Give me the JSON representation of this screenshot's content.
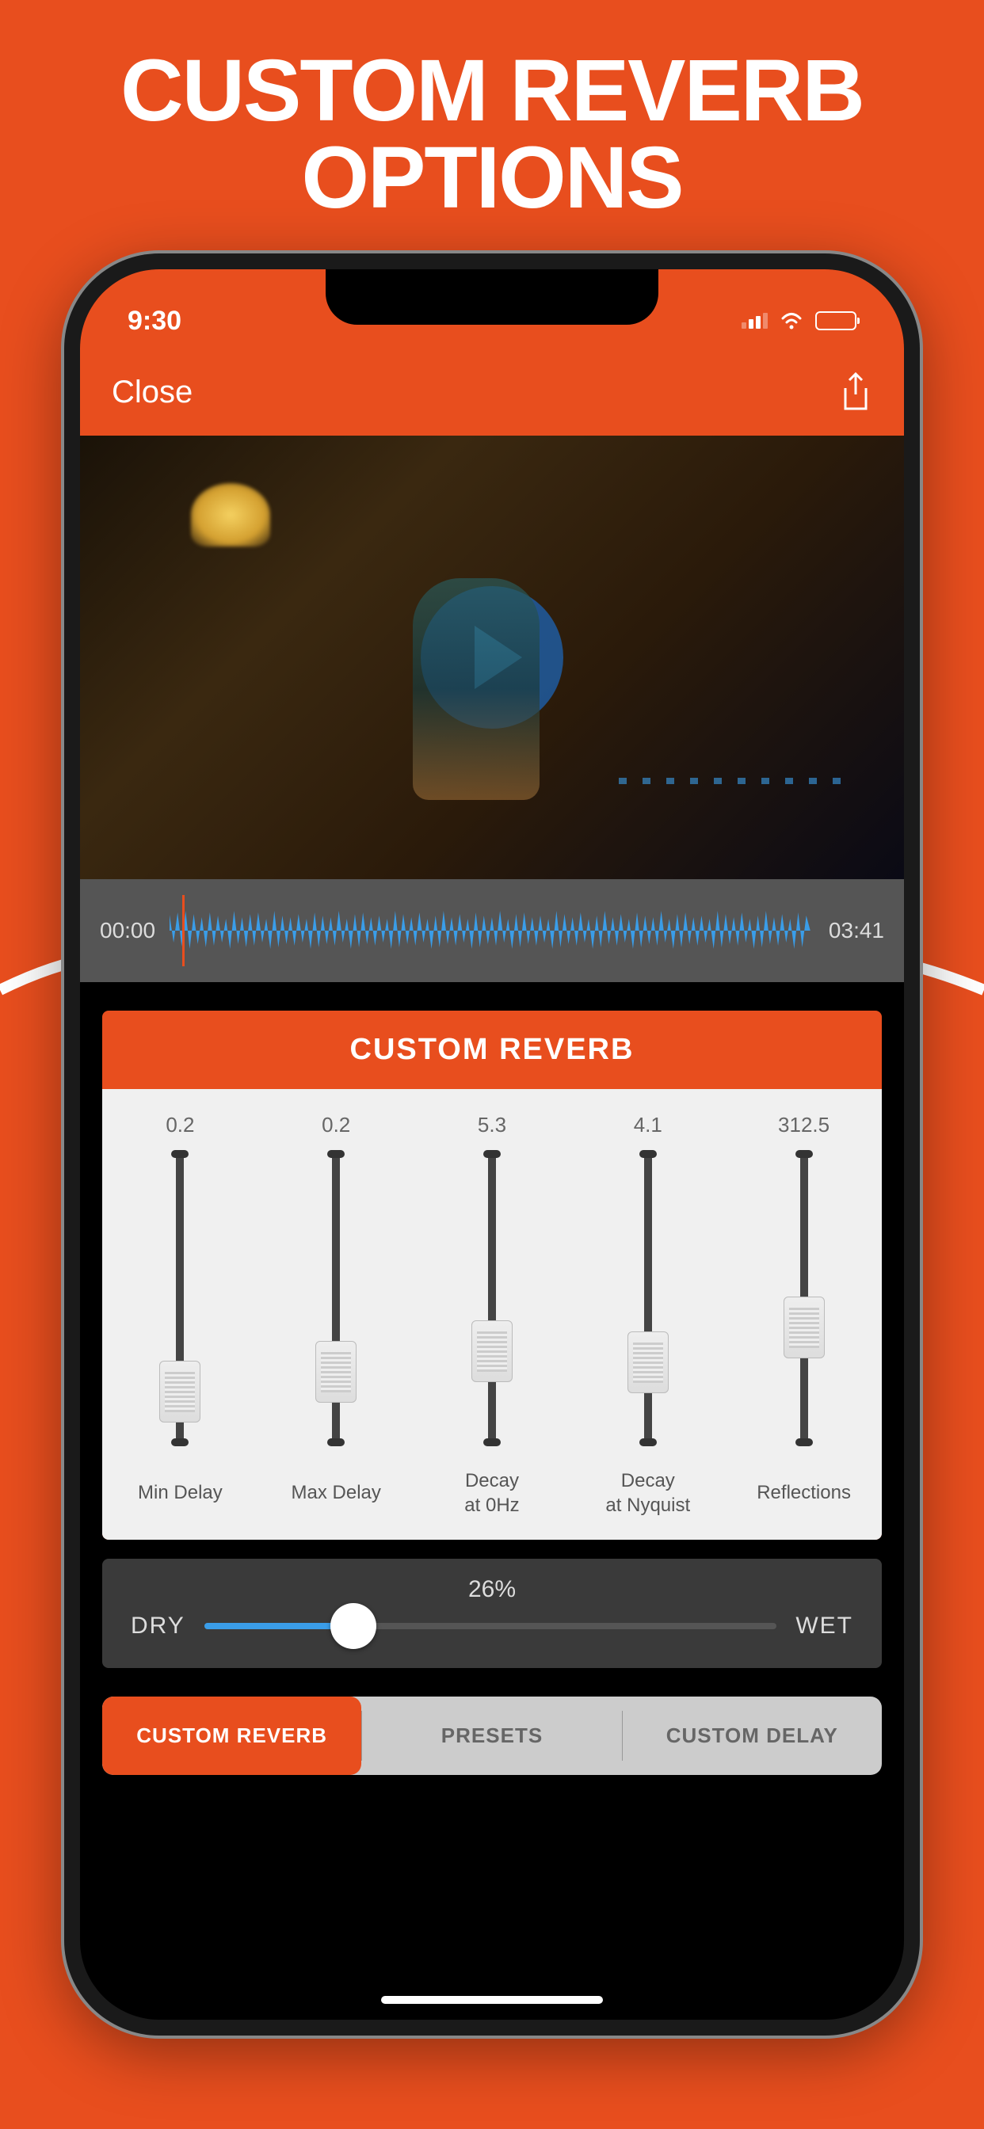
{
  "promo": {
    "title": "CUSTOM REVERB OPTIONS"
  },
  "status": {
    "time": "9:30"
  },
  "nav": {
    "close_label": "Close"
  },
  "timeline": {
    "start": "00:00",
    "end": "03:41"
  },
  "panel": {
    "title": "CUSTOM REVERB"
  },
  "sliders": [
    {
      "value": "0.2",
      "label": "Min Delay",
      "pos": 0.82
    },
    {
      "value": "0.2",
      "label": "Max Delay",
      "pos": 0.75
    },
    {
      "value": "5.3",
      "label": "Decay at 0Hz",
      "pos": 0.68
    },
    {
      "value": "4.1",
      "label": "Decay at Nyquist",
      "pos": 0.72
    },
    {
      "value": "312.5",
      "label": "Reflections",
      "pos": 0.6
    }
  ],
  "mix": {
    "percent": "26%",
    "dry": "DRY",
    "wet": "WET",
    "value": 26
  },
  "tabs": [
    {
      "label": "CUSTOM REVERB",
      "active": true
    },
    {
      "label": "PRESETS",
      "active": false
    },
    {
      "label": "CUSTOM DELAY",
      "active": false
    }
  ]
}
